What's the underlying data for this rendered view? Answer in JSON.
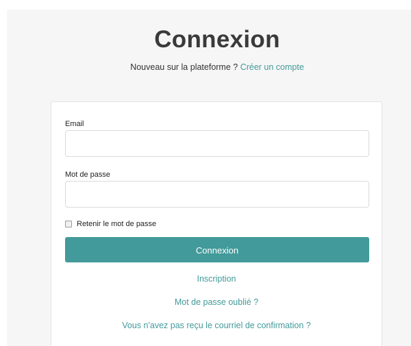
{
  "header": {
    "title": "Connexion",
    "subtitle_text": "Nouveau sur la plateforme ?",
    "create_account_link": "Créer un compte"
  },
  "form": {
    "email_label": "Email",
    "email_value": "",
    "email_placeholder": "",
    "password_label": "Mot de passe",
    "password_value": "",
    "password_placeholder": "",
    "remember_label": "Retenir le mot de passe",
    "remember_checked": false,
    "submit_label": "Connexion"
  },
  "links": {
    "signup": "Inscription",
    "forgot_password": "Mot de passe oublié ?",
    "resend_confirmation": "Vous n'avez pas reçu le courriel de confirmation ?"
  },
  "colors": {
    "accent": "#439a9a",
    "background": "#f6f6f6",
    "title": "#3a3a3a"
  }
}
